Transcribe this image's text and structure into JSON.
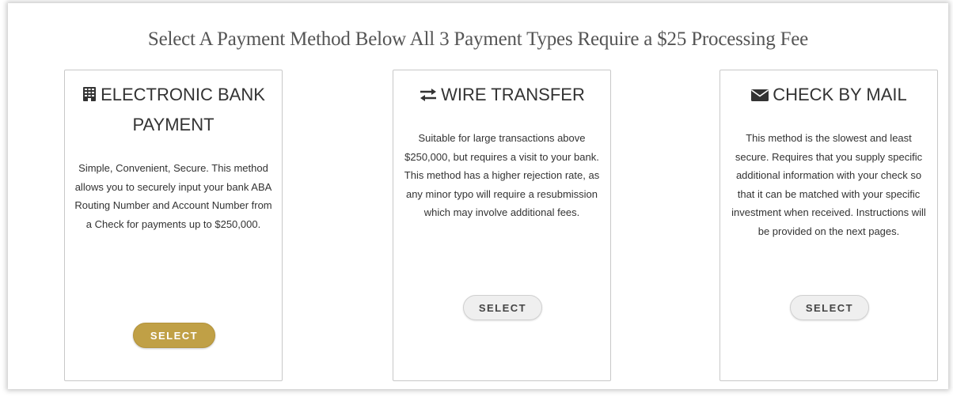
{
  "heading": "Select A Payment Method Below All 3 Payment Types Require a $25 Processing Fee",
  "cards": [
    {
      "icon": "bank-building-icon",
      "title_line1": "ELECTRONIC BANK",
      "title_line2": "PAYMENT",
      "description": "Simple, Convenient, Secure. This method allows you to securely input your bank ABA Routing Number and Account Number from a Check for payments up to $250,000.",
      "button_label": "SELECT",
      "button_style": "primary"
    },
    {
      "icon": "transfer-arrows-icon",
      "title_line1": "WIRE TRANSFER",
      "description": "Suitable for large transactions above $250,000, but requires a visit to your bank. This method has a higher rejection rate, as any minor typo will require a resubmission which may involve additional fees.",
      "button_label": "SELECT",
      "button_style": "default"
    },
    {
      "icon": "envelope-icon",
      "title_line1": "CHECK BY MAIL",
      "description": "This method is the slowest and least secure. Requires that you supply specific additional information with your check so that it can be matched with your specific investment when received. Instructions will be provided on the next pages.",
      "button_label": "SELECT",
      "button_style": "default"
    }
  ],
  "colors": {
    "primary_button": "#c0a046",
    "default_button": "#efefef",
    "heading_text": "#555555"
  }
}
